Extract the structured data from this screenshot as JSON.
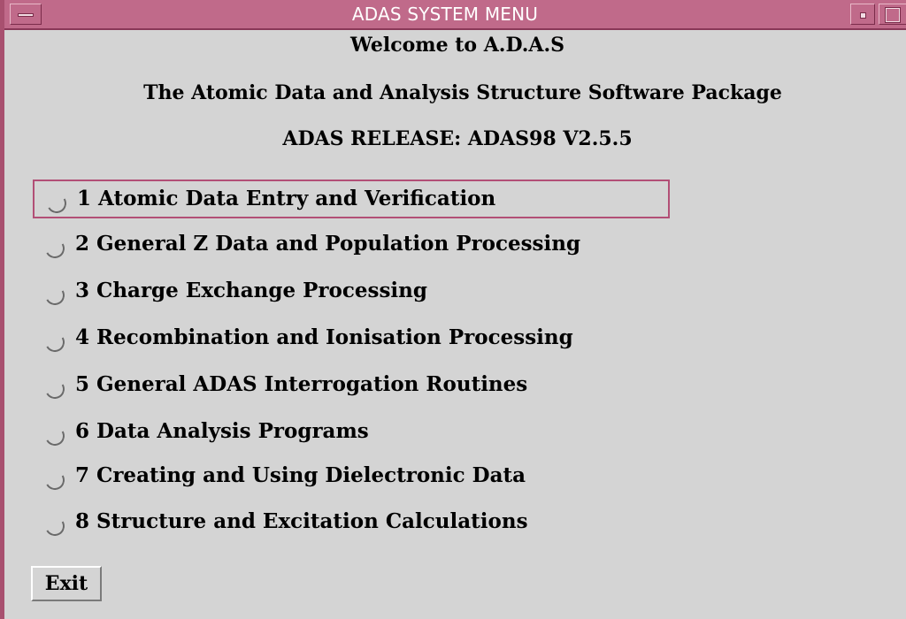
{
  "window": {
    "title": "ADAS SYSTEM MENU",
    "accent_color": "#c06a8a"
  },
  "header": {
    "welcome": "Welcome to A.D.A.S",
    "subtitle": "The Atomic Data and Analysis Structure Software Package",
    "release": "ADAS RELEASE: ADAS98 V2.5.5"
  },
  "options": [
    {
      "label": "1 Atomic Data Entry and Verification",
      "selected": false,
      "focused": true
    },
    {
      "label": "2 General Z Data and Population Processing",
      "selected": false
    },
    {
      "label": "3 Charge Exchange Processing",
      "selected": false
    },
    {
      "label": "4 Recombination and Ionisation Processing",
      "selected": false
    },
    {
      "label": "5 General ADAS Interrogation Routines",
      "selected": false
    },
    {
      "label": "6 Data Analysis Programs",
      "selected": false
    },
    {
      "label": "7 Creating and Using Dielectronic Data",
      "selected": false
    },
    {
      "label": "8 Structure and Excitation Calculations",
      "selected": false
    }
  ],
  "actions": {
    "exit_label": "Exit"
  }
}
